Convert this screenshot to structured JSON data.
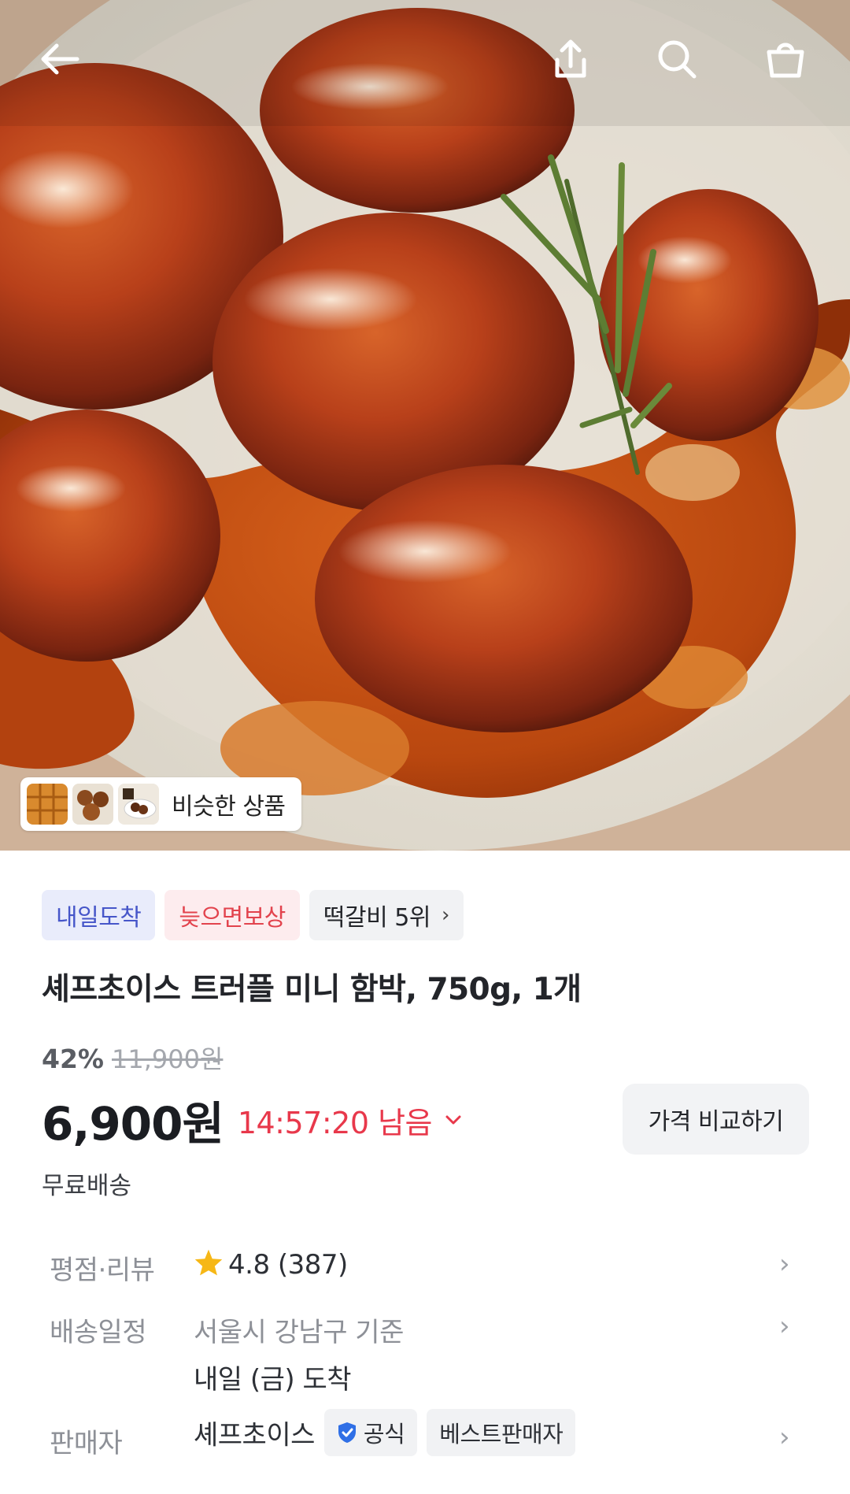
{
  "topbar": {
    "back_icon": "arrow-left-icon",
    "share_icon": "share-icon",
    "search_icon": "search-icon",
    "cart_icon": "shopping-bag-icon"
  },
  "similar": {
    "label": "비슷한 상품"
  },
  "badges": [
    {
      "label": "내일도착"
    },
    {
      "label": "늦으면보상"
    },
    {
      "label": "떡갈비 5위"
    }
  ],
  "product": {
    "title": "셰프초이스 트러플 미니 함박, 750g, 1개",
    "discount": "42%",
    "original_price": "11,900원",
    "price": "6,900원",
    "timer": "14:57:20 남음",
    "compare_label": "가격 비교하기",
    "shipping": "무료배송"
  },
  "rating": {
    "label": "평점·리뷰",
    "score": "4.8",
    "count": "(387)"
  },
  "delivery": {
    "label": "배송일정",
    "line1": "서울시 강남구 기준",
    "line2": "내일 (금) 도착"
  },
  "seller": {
    "label": "판매자",
    "name": "셰프초이스",
    "official": "공식",
    "best": "베스트판매자"
  },
  "colors": {
    "accent_red": "#e8384b",
    "badge_blue": "#4656c9",
    "badge_red": "#e2434d",
    "star": "#f6b716"
  }
}
